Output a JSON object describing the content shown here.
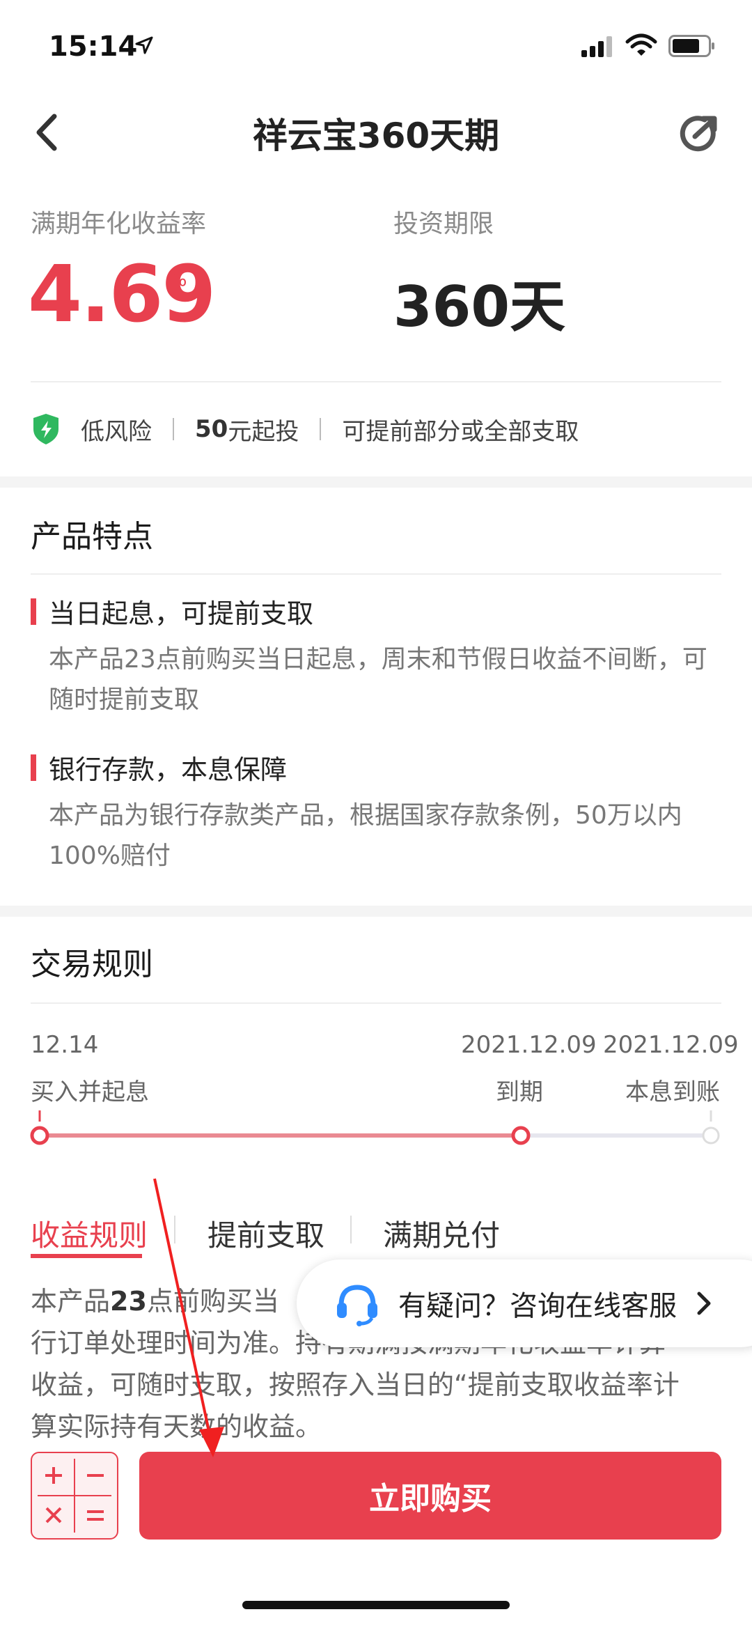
{
  "status_bar": {
    "time": "15:14"
  },
  "nav": {
    "title": "祥云宝360天期"
  },
  "header": {
    "rate_label": "满期年化收益率",
    "rate_value": "4.69",
    "rate_unit": "%",
    "term_label": "投资期限",
    "term_value": "360天"
  },
  "risk_row": {
    "risk": "低风险",
    "min_amount": "50",
    "min_suffix": "元起投",
    "withdraw": "可提前部分或全部支取"
  },
  "features": {
    "title": "产品特点",
    "items": [
      {
        "title": "当日起息，可提前支取",
        "desc": "本产品23点前购买当日起息，周末和节假日收益不间断，可随时提前支取"
      },
      {
        "title": "银行存款，本息保障",
        "desc": "本产品为银行存款类产品，根据国家存款条例，50万以内100%赔付"
      }
    ]
  },
  "rules": {
    "title": "交易规则",
    "timeline": [
      {
        "date": "12.14",
        "label": "买入并起息"
      },
      {
        "date": "2021.12.09",
        "label": "到期"
      },
      {
        "date": "2021.12.09",
        "label": "本息到账"
      }
    ],
    "tabs": [
      "收益规则",
      "提前支取",
      "满期兑付"
    ],
    "active_tab": "收益规则",
    "rule_text_prefix": "本产品",
    "rule_text_bold": "23",
    "rule_text_line1_rest": "点前购买当",
    "rule_text_line2": "行订单处理时间为准。持有期满按满期年化收益率计算",
    "rule_text_line3": "收益，可随时支取，按照存入当日的“提前支取收益率计",
    "rule_text_line4": "算实际持有天数的收益。"
  },
  "customer_service": {
    "label": "有疑问？咨询在线客服"
  },
  "bottom": {
    "buy_label": "立即购买"
  },
  "colors": {
    "accent": "#e8404e",
    "shield": "#2fb85f"
  },
  "icons": [
    "back-arrow-icon",
    "share-icon",
    "shield-icon",
    "headset-icon",
    "chevron-right-icon",
    "calculator-icon"
  ]
}
